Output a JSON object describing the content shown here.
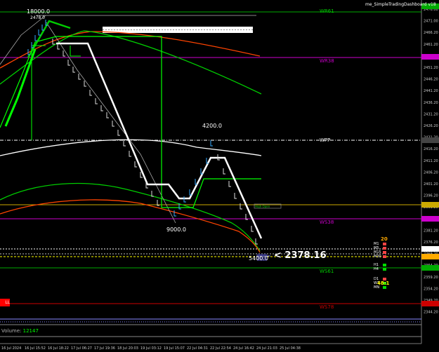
{
  "header": {
    "title": "me_SimpleTradingDashboard  v18"
  },
  "price_axis": {
    "ticks": [
      "2476.00",
      "2471.00",
      "2466.20",
      "2461.20",
      "2456.20",
      "2451.20",
      "2446.20",
      "2441.20",
      "2436.20",
      "2431.20",
      "2426.20",
      "2421.20",
      "2416.20",
      "2411.20",
      "2406.20",
      "2401.20",
      "2396.20",
      "2391.20",
      "2386.20",
      "2381.20",
      "2376.20",
      "2369.20",
      "2364.20",
      "2359.20",
      "2354.20",
      "2349.20",
      "2344.20"
    ]
  },
  "time_axis": {
    "ticks": [
      "16 Jul 2024",
      "16 Jul 15:52",
      "16 Jul 18:22",
      "17 Jul 06:27",
      "17 Jul 19:36",
      "18 Jul 20:03",
      "19 Jul 03:12",
      "19 Jul 15:07",
      "22 Jul 04:31",
      "22 Jul 22:54",
      "24 Jul 16:42",
      "24 Jul 21:03",
      "25 Jul 04:38"
    ]
  },
  "levels": {
    "wr61": "WR61",
    "wr38": "WR38",
    "wpp": "WPP",
    "ws38": "WS38",
    "ws61": "WS61",
    "ws78": "WS78",
    "hline_label": "High Open"
  },
  "markers": {
    "top": "18000.0",
    "top_small": "2478.0",
    "mid": "4200.0",
    "low": "9000.0",
    "last": "5400.0"
  },
  "price_callout": "< 2378.16",
  "sell_label": "LL",
  "volume": {
    "label": "Volume:",
    "value": "12147"
  },
  "dashboard": {
    "count": "20",
    "rows": [
      "M1",
      "M5",
      "M15",
      "M30",
      "H1",
      "H4",
      "D1",
      "W1",
      "MN"
    ],
    "ratio": "48:1"
  }
}
